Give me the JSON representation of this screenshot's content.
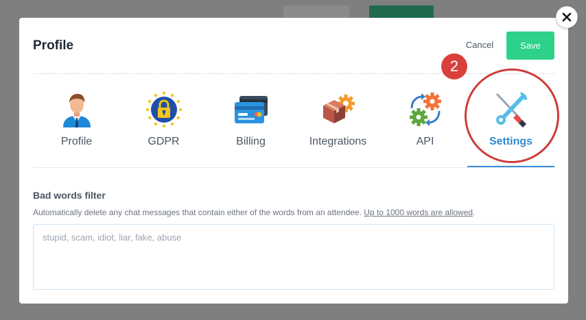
{
  "dialog": {
    "title": "Profile",
    "cancel_label": "Cancel",
    "save_label": "Save"
  },
  "tabs": [
    {
      "label": "Profile",
      "icon": "user-icon",
      "active": false
    },
    {
      "label": "GDPR",
      "icon": "eu-lock-icon",
      "active": false
    },
    {
      "label": "Billing",
      "icon": "credit-card-icon",
      "active": false
    },
    {
      "label": "Integrations",
      "icon": "box-gear-icon",
      "active": false
    },
    {
      "label": "API",
      "icon": "gears-icon",
      "active": false
    },
    {
      "label": "Settings",
      "icon": "wrench-screwdriver-icon",
      "active": true
    }
  ],
  "annotation": {
    "step": "2"
  },
  "bad_words": {
    "title": "Bad words filter",
    "description": "Automatically delete any chat messages that contain either of the words from an attendee.",
    "link_text": "Up to 1000 words are allowed",
    "suffix": ".",
    "placeholder": "stupid, scam, idiot, liar, fake, abuse"
  },
  "colors": {
    "save": "#2dd18a",
    "active_tab": "#2f8ad0",
    "annotation": "#cf3a3a"
  }
}
